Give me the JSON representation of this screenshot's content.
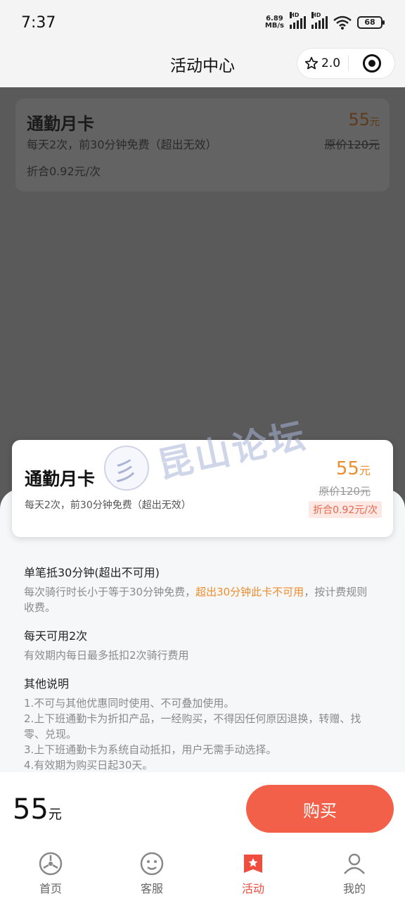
{
  "status_bar": {
    "time": "7:37",
    "net_speed_value": "6.89",
    "net_speed_unit": "MB/s",
    "hd_label": "HD",
    "battery": "68"
  },
  "nav": {
    "title": "活动中心",
    "rating": "2.0"
  },
  "bg_card": {
    "title": "通勤月卡",
    "description": "每天2次，前30分钟免费（超出无效）",
    "ratio": "折合0.92元/次",
    "price": "55",
    "price_unit": "元",
    "original_price": "原价120元"
  },
  "card": {
    "title": "通勤月卡",
    "description": "每天2次，前30分钟免费（超出无效）",
    "price": "55",
    "price_unit": "元",
    "original_price": "原价120元",
    "ratio_badge": "折合0.92元/次"
  },
  "watermark": {
    "text": "昆山论坛"
  },
  "details": {
    "section1_title": "单笔抵30分钟(超出不可用)",
    "section1_text_a": "每次骑行时长小于等于30分钟免费，",
    "section1_text_highlight": "超出30分钟此卡不可用",
    "section1_text_b": "，按计费规则收费。",
    "section2_title": "每天可用2次",
    "section2_text": "有效期内每日最多抵扣2次骑行费用",
    "section3_title": "其他说明",
    "section3_lines": [
      "1.不可与其他优惠同时使用、不可叠加使用。",
      "2.上下班通勤卡为折扣产品，一经购买，不得因任何原因退换，转赠、找零、兑现。",
      "3.上下班通勤卡为系统自动抵扣，用户无需手动选择。",
      "4.有效期为购买日起30天。"
    ]
  },
  "buy_bar": {
    "total": "55",
    "total_unit": "元",
    "buy_label": "购买"
  },
  "tabs": [
    {
      "label": "首页",
      "icon": "home-icon"
    },
    {
      "label": "客服",
      "icon": "service-icon"
    },
    {
      "label": "活动",
      "icon": "activity-icon",
      "active": true
    },
    {
      "label": "我的",
      "icon": "profile-icon"
    }
  ],
  "colors": {
    "accent_orange": "#ef8c2c",
    "buy_button": "#f3604a",
    "active_tab": "#f04d3f"
  }
}
